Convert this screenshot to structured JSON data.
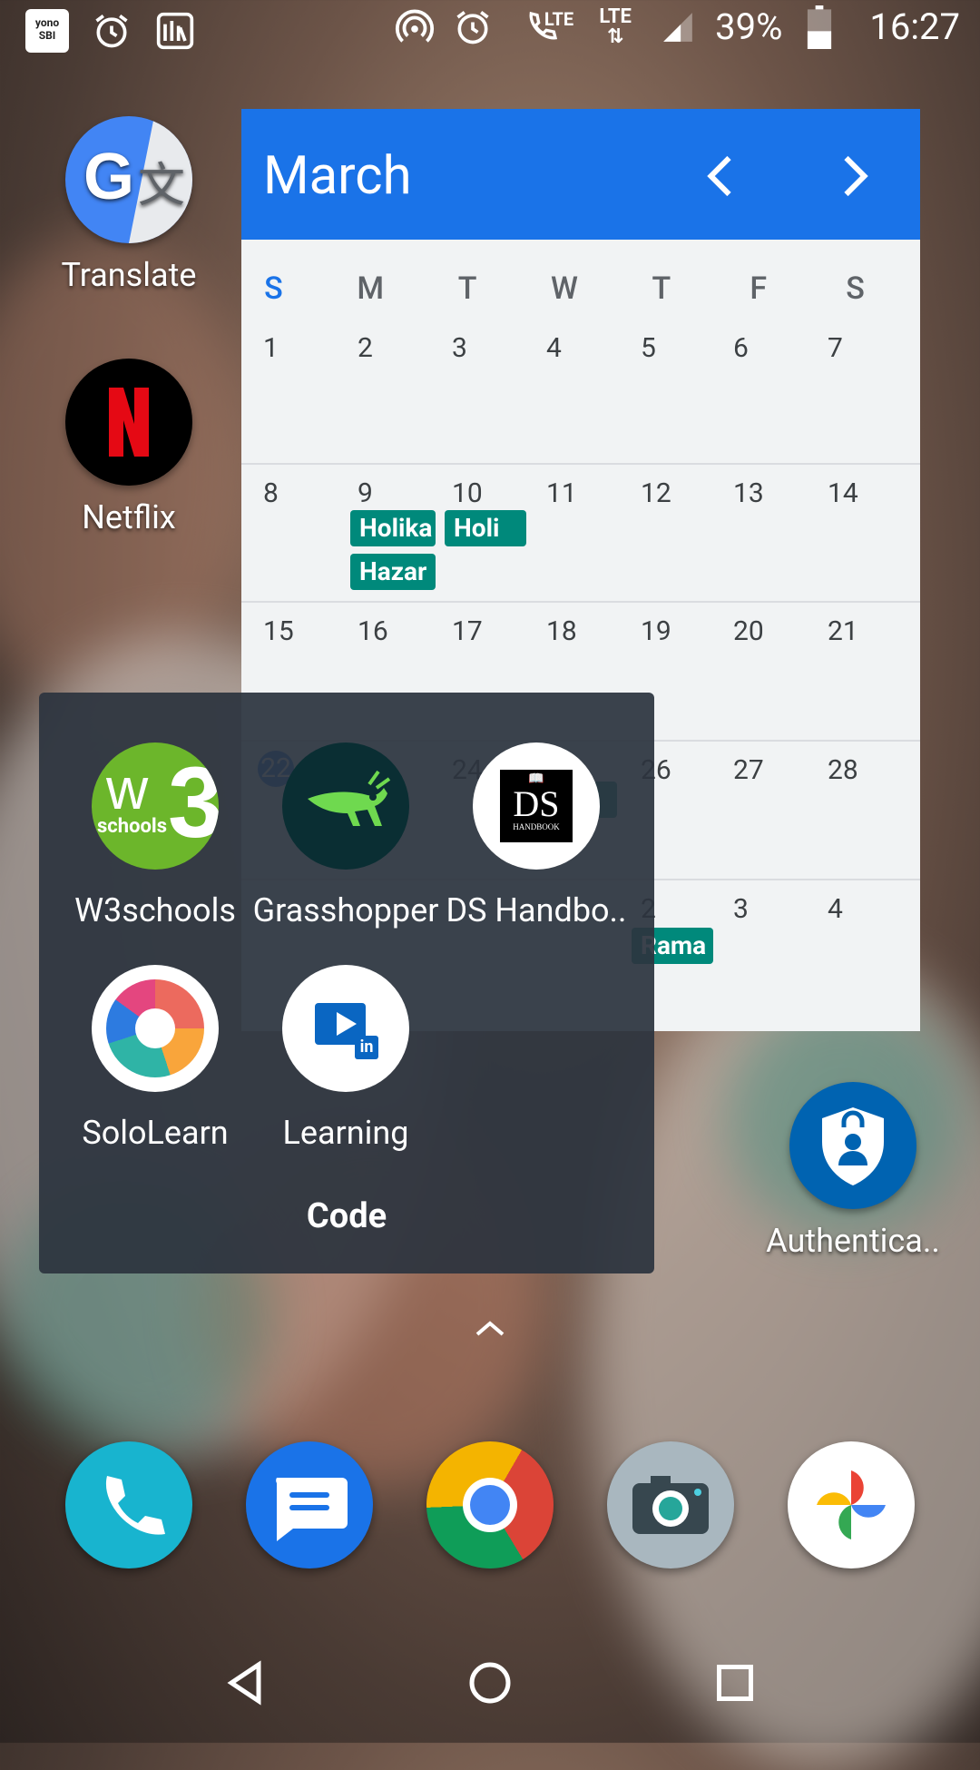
{
  "status_bar": {
    "battery": "39%",
    "time": "16:27",
    "network_1": "LTE",
    "network_2": "LTE",
    "yono_label_1": "yono",
    "yono_label_2": "SBI"
  },
  "desktop": {
    "apps": [
      {
        "label": "Translate",
        "icon": "google-translate-icon"
      },
      {
        "label": "Netflix",
        "icon": "netflix-icon"
      },
      {
        "label": "Authentica..",
        "icon": "authenticator-icon"
      }
    ]
  },
  "calendar": {
    "month": "March",
    "weekdays": [
      "S",
      "M",
      "T",
      "W",
      "T",
      "F",
      "S"
    ],
    "weeks": [
      [
        "1",
        "2",
        "3",
        "4",
        "5",
        "6",
        "7"
      ],
      [
        "8",
        "9",
        "10",
        "11",
        "12",
        "13",
        "14"
      ],
      [
        "15",
        "16",
        "17",
        "18",
        "19",
        "20",
        "21"
      ],
      [
        "22",
        "",
        "24",
        "",
        "26",
        "27",
        "28"
      ],
      [
        "",
        "",
        "",
        "",
        "2",
        "3",
        "4"
      ]
    ],
    "events": [
      "Holika",
      "Hazar",
      "Holi",
      "ti",
      "Rama"
    ],
    "accent": "#1a73e8",
    "event_color": "#00897b"
  },
  "folder": {
    "name": "Code",
    "apps": [
      {
        "label": "W3schools",
        "icon_text": "schools"
      },
      {
        "label": "Grasshopper"
      },
      {
        "label": "DS Handbo..",
        "icon_text_1": "DS",
        "icon_text_2": "HANDBOOK"
      },
      {
        "label": "SoloLearn"
      },
      {
        "label": "Learning",
        "icon_text": "in"
      }
    ]
  },
  "dock": [
    "phone-icon",
    "messages-icon",
    "chrome-icon",
    "camera-icon",
    "photos-icon"
  ]
}
